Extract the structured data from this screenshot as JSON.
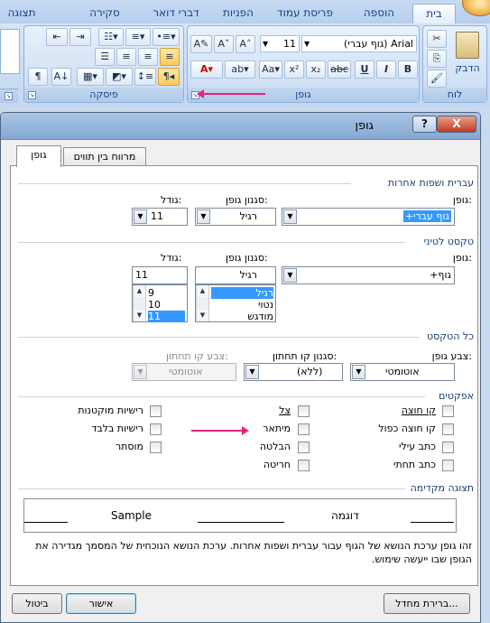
{
  "ribbon": {
    "tabs": [
      "בית",
      "הוספה",
      "פריסת עמוד",
      "הפניות",
      "דברי דואר",
      "סקירה",
      "תצוגה"
    ],
    "groups": {
      "clipboard": "לוח",
      "font": "גופן",
      "paragraph": "פיסקה"
    },
    "paste_label": "הדבק",
    "font_name": "(גוף עברי) Arial",
    "font_size": "11"
  },
  "dialog": {
    "title": "גופן",
    "help": "?",
    "close": "X",
    "tabs": [
      "גופן",
      "מרווח בין תווים"
    ],
    "hebrew_section": {
      "title": "עברית ושפות אחרות",
      "font_label": "גופן:",
      "style_label": "סגנון גופן:",
      "size_label": "גודל:",
      "font_value": "+גוף עברי",
      "style_value": "רגיל",
      "size_value": "11"
    },
    "latin_section": {
      "title": "טקסט לטיני",
      "font_label": "גופן:",
      "style_label": "סגנון גופן:",
      "size_label": "גודל:",
      "font_value": "+גוף",
      "style_value": "רגיל",
      "size_value": "11",
      "style_options": [
        "רגיל",
        "נטוי",
        "מודגש"
      ],
      "size_options": [
        "9",
        "10",
        "11"
      ]
    },
    "all_text": {
      "title": "כל הטקסט",
      "color_label": "צבע גופן:",
      "underline_label": "סגנון קו תחתון:",
      "underline_color_label": "צבע קו תחתון:",
      "color_value": "אוטומטי",
      "underline_value": "(ללא)",
      "underline_color_value": "אוטומטי"
    },
    "effects": {
      "title": "אפקטים",
      "right_col": [
        "קו חוצה",
        "קו חוצה כפול",
        "כתב עילי",
        "כתב תחתי"
      ],
      "mid_col": [
        "צל",
        "מיתאר",
        "הבלטה",
        "חריטה"
      ],
      "left_col": [
        "רישיות מוקטנות",
        "רישיות בלבד",
        "מוסתר"
      ]
    },
    "preview": {
      "title": "תצוגה מקדימה",
      "sample_he": "דוגמה",
      "sample_en": "Sample"
    },
    "description": "זהו גופן ערכת הנושא של הגוף עבור עברית ושפות אחרות. ערכת הנושא הנוכחית של המסמך מגדירה את הגופן שבו ייעשה שימוש.",
    "buttons": {
      "default": "ברירת מחדל...",
      "ok": "אישור",
      "cancel": "ביטול"
    }
  },
  "colors": {
    "annotation_arrow": "#e6247b",
    "ribbon_text": "#15428b"
  }
}
